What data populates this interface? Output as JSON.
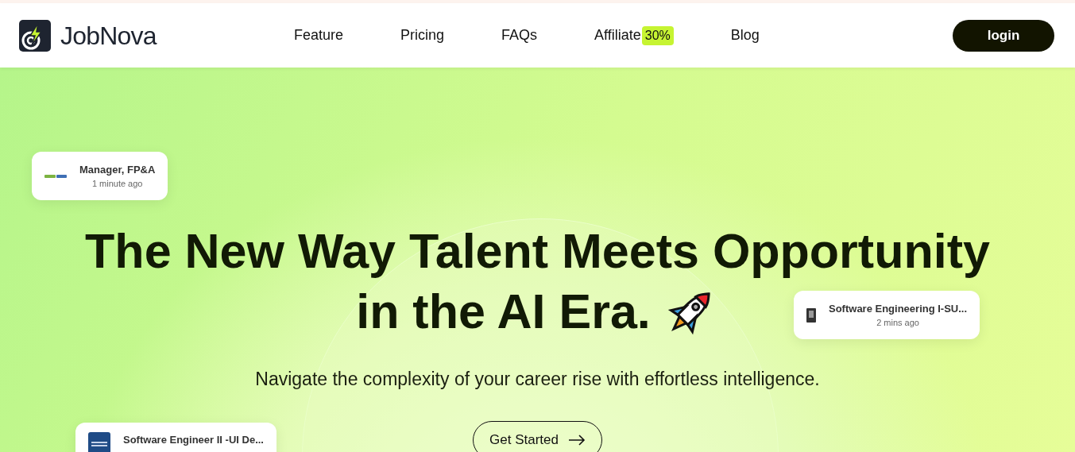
{
  "brand": {
    "name": "JobNova"
  },
  "nav": [
    {
      "label": "Feature"
    },
    {
      "label": "Pricing"
    },
    {
      "label": "FAQs"
    },
    {
      "label": "Affiliate",
      "badge": "30%"
    },
    {
      "label": "Blog"
    }
  ],
  "login": "login",
  "hero": {
    "title_line_1": "The New Way Talent Meets Opportunity",
    "title_line_2": "in the AI Era.",
    "subtitle": "Navigate the complexity of your career rise with effortless intelligence.",
    "cta": "Get Started"
  },
  "job_cards": [
    {
      "title": "Manager, FP&A",
      "time": "1 minute ago",
      "kind": "green-logo"
    },
    {
      "title": "Software Engineering I-SU...",
      "time": "2 mins ago",
      "kind": "dark-logo"
    },
    {
      "title": "Software Engineer II -UI De...",
      "kind": "blue-logo"
    }
  ]
}
